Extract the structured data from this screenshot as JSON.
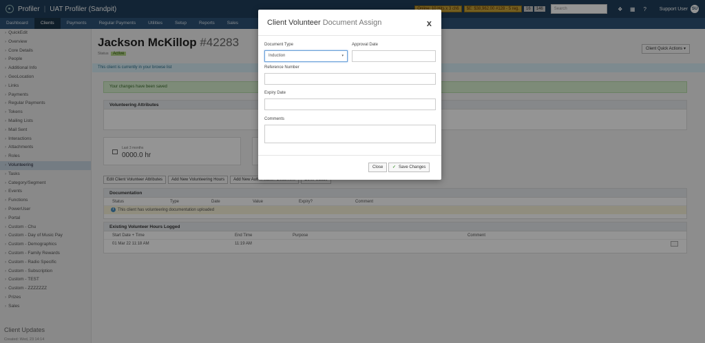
{
  "topbar": {
    "app_name": "Profiler",
    "env_name": "UAT Profiler (Sandpit)",
    "badge_online": "Online: 10 Hits x 3 ch6",
    "badge_money": "$E: $38,962.00 #128 - 5 reg.",
    "badge_num1": "16",
    "badge_num2": "146",
    "search_placeholder": "Search",
    "user_name": "Support User",
    "user_initials": "SU"
  },
  "nav": [
    "Dashboard",
    "Clients",
    "Payments",
    "Regular Payments",
    "Utilities",
    "Setup",
    "Reports",
    "Sales"
  ],
  "sidebar": {
    "items": [
      "QuickEdit",
      "Overview",
      "Core Details",
      "People",
      "Additional Info",
      "GeoLocation",
      "Links",
      "Payments",
      "Regular Payments",
      "Tokens",
      "Mailing Lists",
      "Mail Sent",
      "Interactions",
      "Attachments",
      "Roles",
      "Volunteering",
      "Tasks",
      "Category/Segment",
      "Events",
      "Functions",
      "PowerUser",
      "Portal",
      "Custom - Chu",
      "Custom - Day of Music Pay",
      "Custom - Demographics",
      "Custom - Family Rewards",
      "Custom - Radio Specific",
      "Custom - Subscription",
      "Custom - TEST",
      "Custom - ZZZZZZZ",
      "Prizes",
      "Sales"
    ],
    "heading": "Client Updates",
    "sub": "Created: Wed, 23 14:14"
  },
  "client": {
    "name": "Jackson McKillop",
    "id": "#42283",
    "status_label": "Status",
    "status": "Active",
    "quick_actions": "Client Quick Actions ▾",
    "browse_msg": "This client is currently in your browse list",
    "success_msg": "Your changes have been saved"
  },
  "volunteering": {
    "attributes_title": "Volunteering Attributes",
    "stat_label": "Last 3 months",
    "stat_value": "0000.0 hr",
    "buttons": [
      "Edit Client Volunteer Attributes",
      "Add New Volunteering Hours",
      "Add New Authorisation Document",
      "Other Status"
    ],
    "documentation_title": "Documentation",
    "doc_columns": [
      "Status",
      "Type",
      "Date",
      "Value",
      "Expiry?",
      "Comment"
    ],
    "doc_empty": "This client has volunteering documentation uploaded",
    "hours_title": "Existing Volunteer Hours Logged",
    "hours_columns": [
      "Start Date + Time",
      "End Time",
      "Purpose",
      "Comment"
    ],
    "hours_row": {
      "start": "01 Mar 22 11:18 AM",
      "end": "11:19 AM"
    }
  },
  "modal": {
    "title_main": "Client Volunteer",
    "title_sub": "Document Assign",
    "close": "x",
    "document_type_label": "Document Type",
    "document_type_value": "Induction",
    "approval_date_label": "Approval Date",
    "reference_label": "Reference Number",
    "expiry_label": "Expiry Date",
    "comments_label": "Comments",
    "close_button": "Close",
    "save_button": "Save Changes"
  },
  "colors": {
    "topbar": "#1f3f5c",
    "nav": "#2d5477",
    "accent_blue": "#6aa0d8",
    "success": "#d7efcf"
  }
}
